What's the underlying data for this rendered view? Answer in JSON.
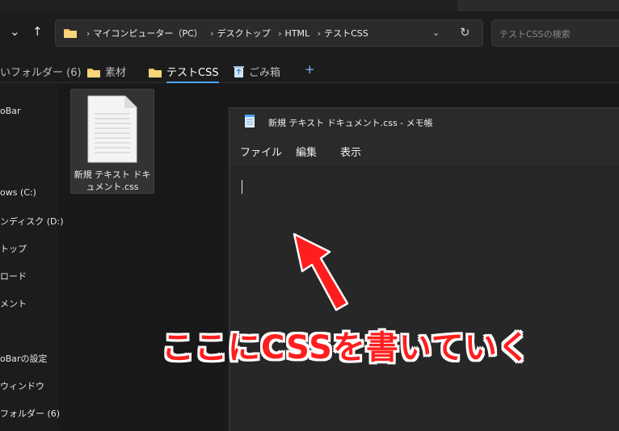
{
  "nav": {
    "back_arrow": "⌄",
    "up_arrow": "↑",
    "breadcrumbs": [
      "マイコンピューター（PC）",
      "デスクトップ",
      "HTML",
      "テストCSS"
    ],
    "breadcrumb_separator": "›",
    "dropdown_glyph": "⌄",
    "refresh_glyph": "↻",
    "search_placeholder": "テストCSSの検索"
  },
  "tabs": [
    {
      "label": "いフォルダー (6)",
      "icon": "none"
    },
    {
      "label": "素材",
      "icon": "folder-icon"
    },
    {
      "label": "テストCSS",
      "icon": "folder-icon",
      "active": true
    },
    {
      "label": "ごみ箱",
      "icon": "recycle-bin-icon"
    }
  ],
  "tab_add": "+",
  "sidebar": {
    "items": [
      "oBar",
      "ows (C:)",
      "ンディスク (D:)",
      "トップ",
      "ロード",
      "メント",
      "oBarの設定",
      "ウィンドウ",
      "フォルダー (6)"
    ]
  },
  "file": {
    "name": "新規 テキスト ドキュメント.css"
  },
  "notepad": {
    "title": "新規 テキスト ドキュメント.css - メモ帳",
    "menu": [
      "ファイル",
      "編集",
      "表示"
    ]
  },
  "annotation": {
    "text": "ここにCSSを書いていく"
  },
  "colors": {
    "accent": "#4ca6ff",
    "annotation_red": "#ff1e1e",
    "folder_yellow": "#f2c14e"
  }
}
